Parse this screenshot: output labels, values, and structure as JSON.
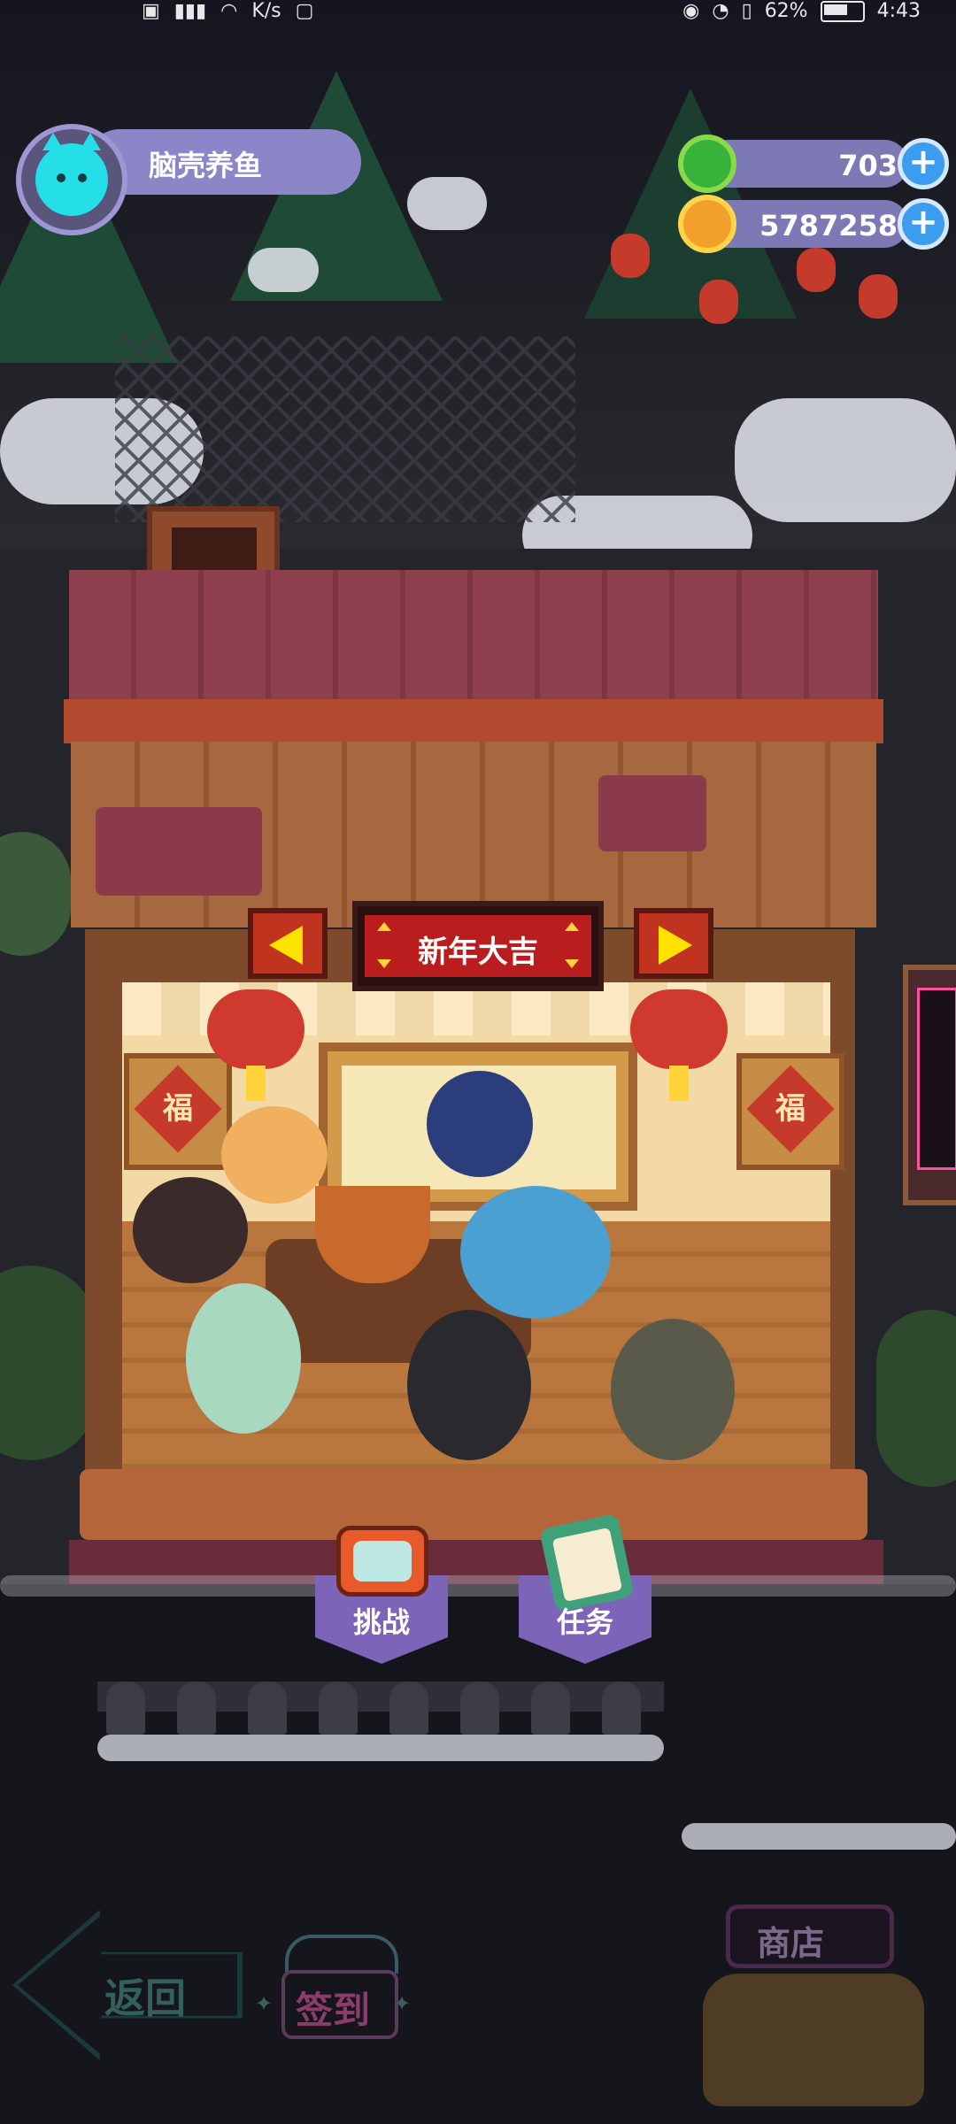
{
  "status_bar": {
    "left_text": "K/s",
    "battery": "62%",
    "time": "4:43"
  },
  "player": {
    "name": "脑壳养鱼",
    "avatar_icon": "cyan-cat-face"
  },
  "currencies": [
    {
      "icon": "green-donut-coin-icon",
      "value": "703",
      "color": "#37b23b"
    },
    {
      "icon": "orange-planet-coin-icon",
      "value": "5787258",
      "color": "#f3a02a"
    }
  ],
  "shop": {
    "sign_text": "新年大吉",
    "fu_character": "福",
    "accent_red": "#b91d1d",
    "arrow_yellow": "#ffe200"
  },
  "actions": [
    {
      "label": "挑战",
      "icon": "tv-icon"
    },
    {
      "label": "任务",
      "icon": "clipboard-icon"
    }
  ],
  "bottom_nav": {
    "back_label": "返回",
    "sign_in_label": "签到",
    "shop_label": "商店"
  }
}
